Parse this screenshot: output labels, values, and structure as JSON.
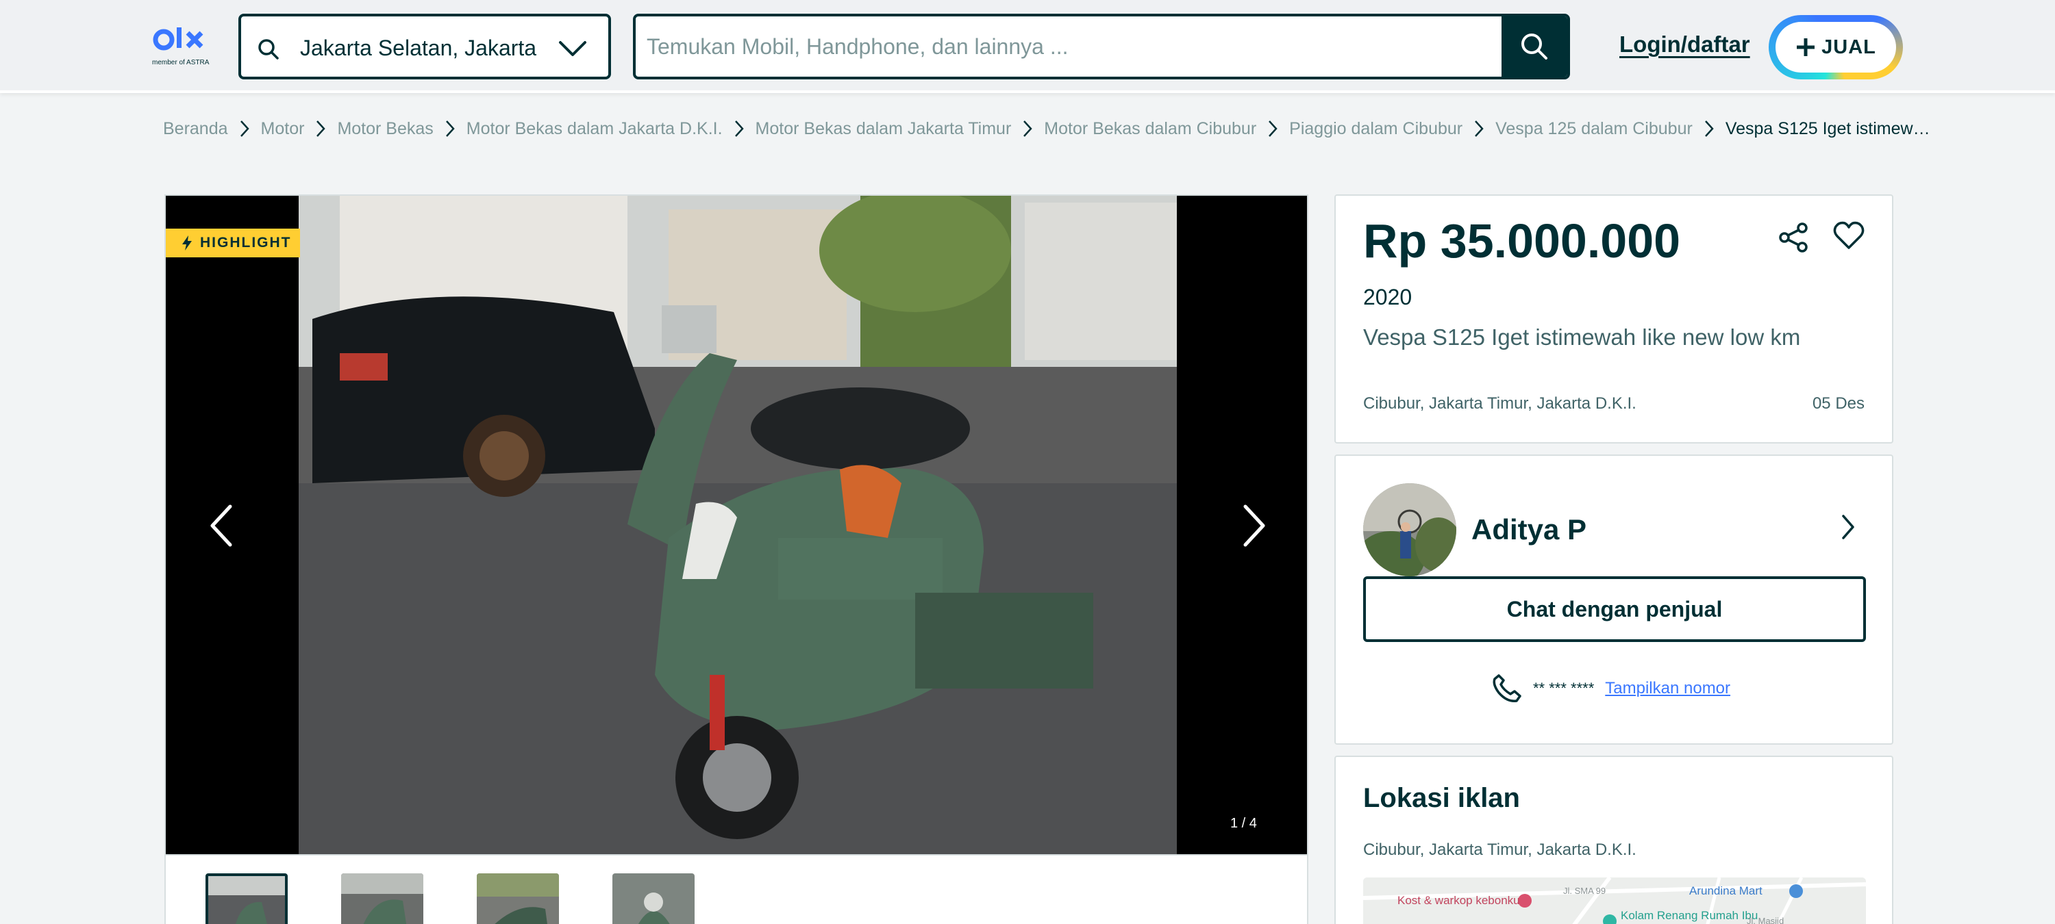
{
  "header": {
    "logo_sub": "member of ASTRA",
    "location_value": "Jakarta Selatan, Jakarta",
    "search_placeholder": "Temukan Mobil, Handphone, dan lainnya ...",
    "login_label": "Login/daftar",
    "sell_label": "JUAL"
  },
  "breadcrumb": [
    "Beranda",
    "Motor",
    "Motor Bekas",
    "Motor Bekas dalam Jakarta D.K.I.",
    "Motor Bekas dalam Jakarta Timur",
    "Motor Bekas dalam Cibubur",
    "Piaggio dalam Cibubur",
    "Vespa 125 dalam Cibubur",
    "Vespa S125 Iget istimew…"
  ],
  "gallery": {
    "badge": "HIGHLIGHT",
    "counter": "1 / 4",
    "thumb_count": 4
  },
  "ad": {
    "price": "Rp 35.000.000",
    "year": "2020",
    "title": "Vespa S125 Iget istimewah like new low km",
    "location": "Cibubur, Jakarta Timur, Jakarta D.K.I.",
    "date": "05 Des"
  },
  "seller": {
    "name": "Aditya P",
    "chat_label": "Chat dengan penjual",
    "masked_phone": "** *** ****",
    "show_number_label": "Tampilkan nomor"
  },
  "location_card": {
    "title": "Lokasi iklan",
    "address": "Cibubur, Jakarta Timur, Jakarta D.K.I.",
    "map_labels": [
      "Kost & warkop kebonku",
      "Arundina Mart",
      "Kolam Renang Rumah Ibu",
      "Jl. SMA 99",
      "Jl. Masjid"
    ]
  },
  "colors": {
    "primary": "#002f34",
    "highlight": "#ffce32",
    "link": "#3a77ff",
    "page_bg": "#f2f4f5"
  },
  "icons": [
    "search-icon",
    "chevron-down-icon",
    "plus-icon",
    "chevron-right-icon",
    "bolt-icon",
    "chevron-left-icon",
    "share-icon",
    "heart-icon",
    "phone-icon"
  ]
}
